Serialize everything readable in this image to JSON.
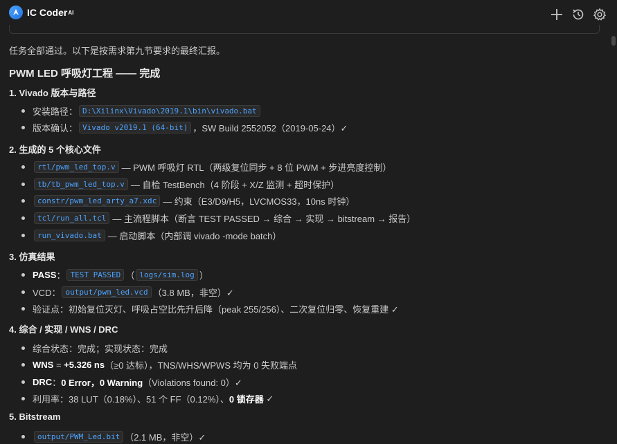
{
  "header": {
    "app_name": "IC Coder",
    "app_sup": "AI"
  },
  "intro": "任务全部通过。以下是按需求第九节要求的最终汇报。",
  "title": "PWM LED 呼吸灯工程 —— 完成",
  "sections": {
    "s1": {
      "heading": "1. Vivado 版本与路径",
      "i1_label": "安装路径：",
      "i1_code": "D:\\Xilinx\\Vivado\\2019.1\\bin\\vivado.bat",
      "i2_label": "版本确认：",
      "i2_code": "Vivado v2019.1 (64-bit)",
      "i2_tail": "，SW Build 2552052（2019-05-24）✓"
    },
    "s2": {
      "heading": "2. 生成的 5 个核心文件",
      "i1_code": "rtl/pwm_led_top.v",
      "i1_tail": "— PWM 呼吸灯 RTL（两级复位同步 + 8 位 PWM + 步进亮度控制）",
      "i2_code": "tb/tb_pwm_led_top.v",
      "i2_tail": "— 自检 TestBench（4 阶段 + X/Z 监测 + 超时保护）",
      "i3_code": "constr/pwm_led_arty_a7.xdc",
      "i3_tail": "— 约束（E3/D9/H5，LVCMOS33，10ns 时钟）",
      "i4_code": "tcl/run_all.tcl",
      "i4_tail": "— 主流程脚本（断言 TEST PASSED → 综合 → 实现 → bitstream → 报告）",
      "i5_code": "run_vivado.bat",
      "i5_tail": "— 启动脚本（内部调 vivado -mode batch）"
    },
    "s3": {
      "heading": "3. 仿真结果",
      "i1_bold": "PASS",
      "i1_colon": "：",
      "i1_code": "TEST PASSED",
      "i1_open": "（",
      "i1_code2": "logs/sim.log",
      "i1_close": "）",
      "i2_label": "VCD：",
      "i2_code": "output/pwm_led.vcd",
      "i2_tail": "（3.8 MB，非空）✓",
      "i3_text": "验证点：初始复位灭灯、呼吸占空比先升后降（peak 255/256）、二次复位归零、恢复重建 ✓"
    },
    "s4": {
      "heading": "4. 综合 / 实现 / WNS / DRC",
      "i1_text": "综合状态：完成；实现状态：完成",
      "i2_bold1": "WNS",
      "i2_mid": " = ",
      "i2_bold2": "+5.326 ns",
      "i2_tail": "（≥0 达标），TNS/WHS/WPWS 均为 0 失败端点",
      "i3_bold1": "DRC",
      "i3_mid": "：",
      "i3_bold2": "0 Error，0 Warning",
      "i3_tail": "（Violations found: 0）✓",
      "i4_text": "利用率：38 LUT（0.18%）、51 个 FF（0.12%）、",
      "i4_bold": "0 锁存器",
      "i4_tail": " ✓"
    },
    "s5": {
      "heading": "5. Bitstream",
      "i1_code": "output/PWM_Led.bit",
      "i1_tail": "（2.1 MB，非空）✓"
    }
  },
  "colors": {
    "background": "#1e1e1e",
    "code_text": "#4da3ff",
    "code_bg": "#2a2a2a",
    "logo": "#3d8ff0"
  },
  "icons": [
    "logo-icon",
    "plus-icon",
    "history-icon",
    "gear-icon"
  ]
}
